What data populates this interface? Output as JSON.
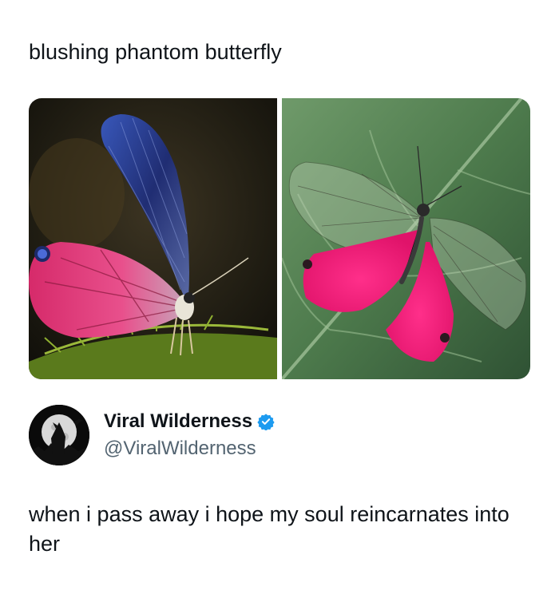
{
  "post": {
    "caption": "blushing phantom butterfly",
    "author": {
      "display_name": "Viral Wilderness",
      "handle": "@ViralWilderness",
      "verified": true,
      "verified_color": "#1d9bf0"
    },
    "text": "when i pass away i hope my soul reincarnates into her"
  },
  "media": {
    "images": [
      {
        "name": "butterfly-side-view"
      },
      {
        "name": "butterfly-on-leaf"
      }
    ]
  },
  "icons": {
    "verified": "verified-badge-icon",
    "avatar": "wolf-howling-moon-avatar"
  }
}
